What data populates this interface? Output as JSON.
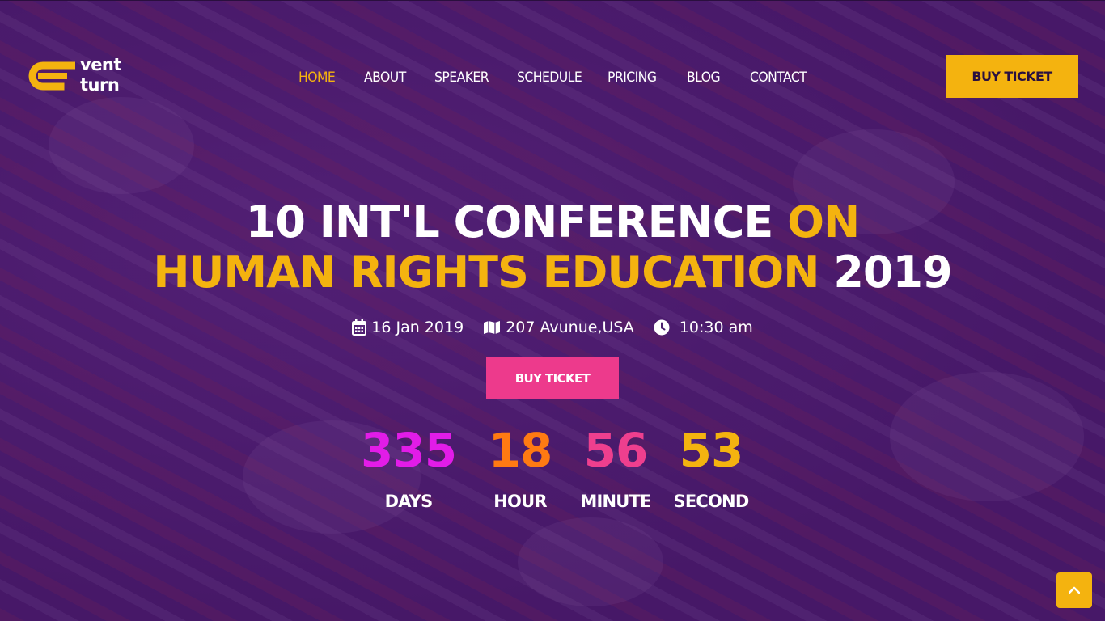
{
  "brand": {
    "logo_line1": "vent",
    "logo_line2": "turn",
    "accent": "#f4b30f"
  },
  "nav": {
    "items": [
      {
        "label": "HOME",
        "active": true
      },
      {
        "label": "ABOUT"
      },
      {
        "label": "SPEAKER"
      },
      {
        "label": "SCHEDULE"
      },
      {
        "label": "PRICING"
      },
      {
        "label": "BLOG"
      },
      {
        "label": "CONTACT"
      }
    ],
    "buy_ticket_label": "BUY TICKET"
  },
  "hero": {
    "title_line1_white": "10 INT'L CONFERENCE",
    "title_line1_yellow": "ON",
    "title_line2_yellow": "HUMAN RIGHTS EDUCATION",
    "title_line2_white": "2019",
    "date": "16 Jan 2019",
    "location": "207 Avunue,USA",
    "time": "10:30 am",
    "buy_ticket_label": "BUY TICKET",
    "button_color": "#ed3a8c"
  },
  "countdown": [
    {
      "value": "335",
      "label": "DAYS",
      "color": "#e21ce8"
    },
    {
      "value": "18",
      "label": "HOUR",
      "color": "#ff7a12"
    },
    {
      "value": "56",
      "label": "MINUTE",
      "color": "#ee3f8e"
    },
    {
      "value": "53",
      "label": "SECOND",
      "color": "#f4b30f"
    }
  ],
  "icons": {
    "calendar": "calendar-icon",
    "map": "map-icon",
    "clock": "clock-icon",
    "back_to_top": "chevron-up-icon"
  }
}
